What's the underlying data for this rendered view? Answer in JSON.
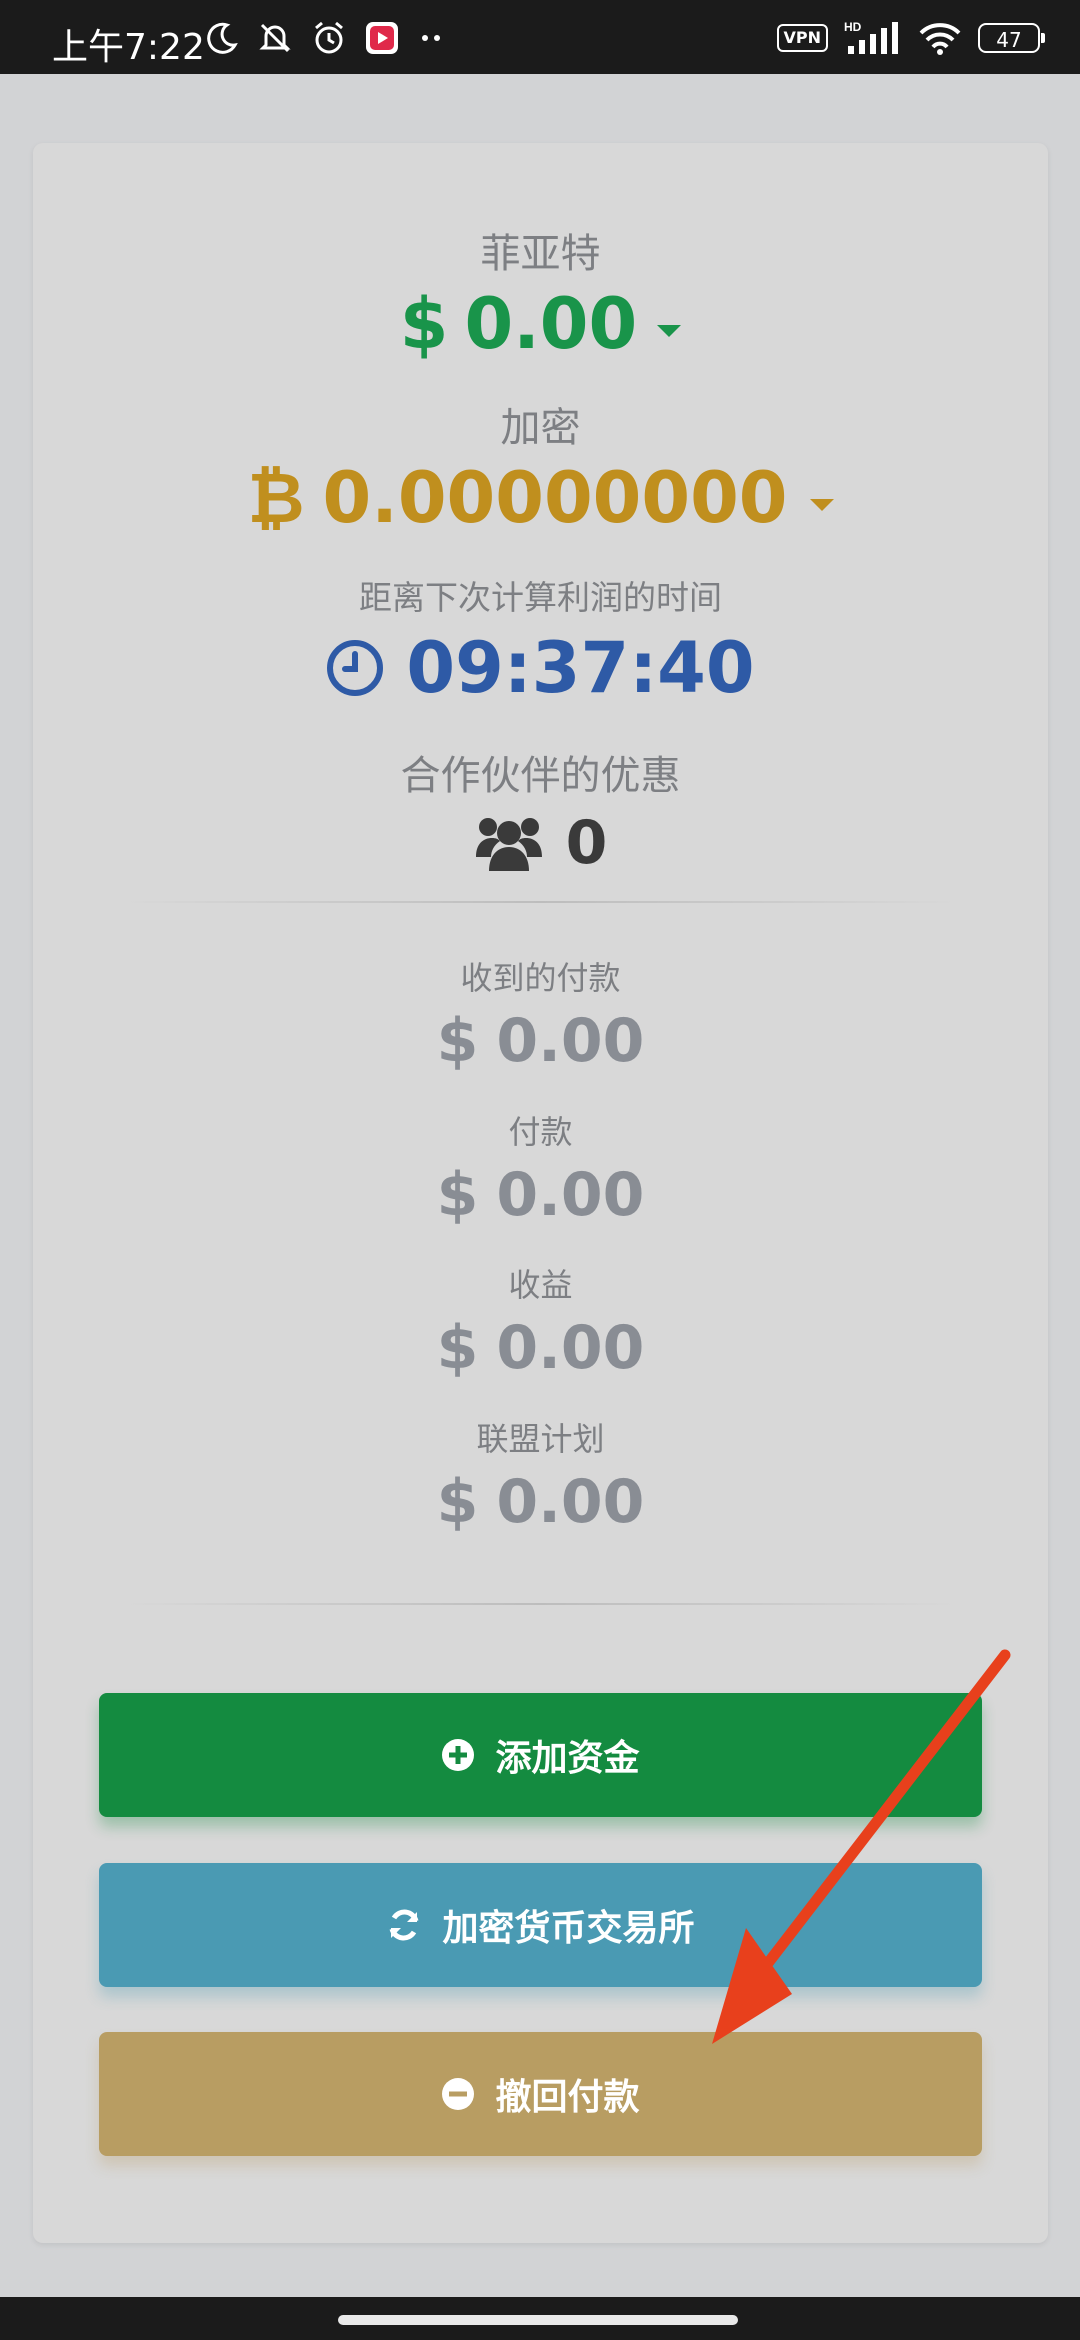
{
  "status_bar": {
    "time": "上午7:22",
    "vpn_label": "VPN",
    "network_label": "HD",
    "battery": "47",
    "icons": [
      "moon-icon",
      "bell-muted-icon",
      "alarm-icon",
      "app-notification-icon",
      "more-dots-icon",
      "signal-icon",
      "wifi-icon",
      "battery-icon"
    ]
  },
  "balance": {
    "fiat_label": "菲亚特",
    "fiat_symbol": "$",
    "fiat_value": "0.00",
    "crypto_label": "加密",
    "crypto_symbol": "₿",
    "crypto_value": "0.00000000"
  },
  "timer": {
    "label": "距离下次计算利润的时间",
    "value": "09:37:40"
  },
  "partners": {
    "label": "合作伙伴的优惠",
    "value": "0"
  },
  "stats": [
    {
      "label": "收到的付款",
      "symbol": "$",
      "value": "0.00"
    },
    {
      "label": "付款",
      "symbol": "$",
      "value": "0.00"
    },
    {
      "label": "收益",
      "symbol": "$",
      "value": "0.00"
    },
    {
      "label": "联盟计划",
      "symbol": "$",
      "value": "0.00"
    }
  ],
  "buttons": {
    "add_funds": "添加资金",
    "exchange": "加密货币交易所",
    "withdraw": "撤回付款"
  },
  "colors": {
    "fiat": "#19944a",
    "crypto": "#c08f1e",
    "timer": "#2e5aa6",
    "add_funds_button": "#148b40",
    "exchange_button": "#4a9ab3",
    "withdraw_button": "#b89d62",
    "annotation_arrow": "#e8401c"
  }
}
